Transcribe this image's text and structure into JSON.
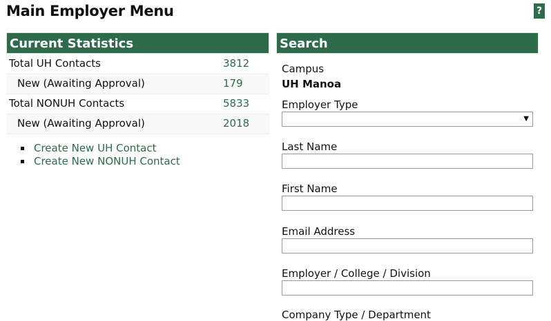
{
  "page": {
    "title": "Main Employer Menu",
    "help_label": "?"
  },
  "stats": {
    "header": "Current Statistics",
    "rows": [
      {
        "label": "Total UH Contacts",
        "value": "3812"
      },
      {
        "label": "New (Awaiting Approval)",
        "value": "179"
      },
      {
        "label": "Total NONUH Contacts",
        "value": "5833"
      },
      {
        "label": "New (Awaiting Approval)",
        "value": "2018"
      }
    ]
  },
  "links": [
    {
      "label": "Create New UH Contact"
    },
    {
      "label": "Create New NONUH Contact"
    }
  ],
  "search": {
    "header": "Search",
    "campus_label": "Campus",
    "campus_value": "UH Manoa",
    "employer_type_label": "Employer Type",
    "employer_type_value": "",
    "last_name_label": "Last Name",
    "last_name_value": "",
    "first_name_label": "First Name",
    "first_name_value": "",
    "email_label": "Email Address",
    "email_value": "",
    "employer_label": "Employer / College / Division",
    "employer_value": "",
    "company_type_label": "Company Type / Department"
  },
  "colors": {
    "accent": "#2e6b4b"
  },
  "icons": {
    "help": "help-icon",
    "select_arrow": "chevron-down-icon",
    "bullet": "bullet-icon"
  }
}
